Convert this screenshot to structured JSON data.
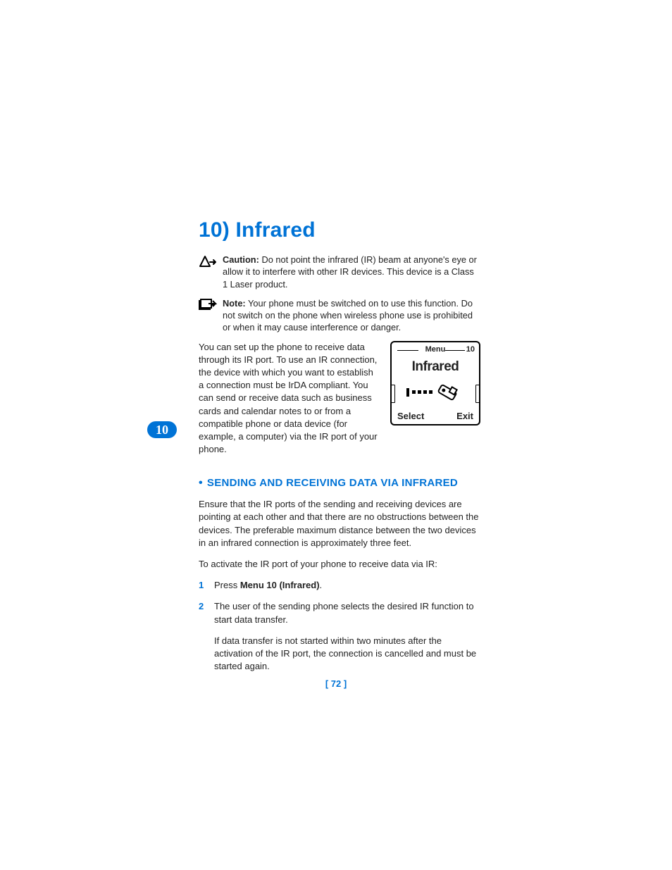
{
  "title": "10) Infrared",
  "caution": {
    "label": "Caution:",
    "text": " Do not point the infrared (IR) beam at anyone's eye or allow it to interfere with other IR devices. This device is a Class 1 Laser product."
  },
  "note": {
    "label": "Note:",
    "text": "  Your phone must be switched on to use this function. Do not switch on the phone when wireless phone use is prohibited or when it may cause interference or danger."
  },
  "intro": "You can set up the phone to receive data through its IR port. To use an IR connection, the device with which you want to establish a connection must be IrDA compliant. You can send or receive data such as business cards and calendar notes to or from a compatible phone or data device (for example, a computer) via the IR port of your phone.",
  "phone": {
    "menu_label": "Menu",
    "menu_number": "10",
    "title": "Infrared",
    "softkey_left": "Select",
    "softkey_right": "Exit"
  },
  "chapter_tab": "10",
  "section_heading": "SENDING AND RECEIVING DATA VIA INFRARED",
  "ensure_para": "Ensure that the IR ports of the sending and receiving devices are pointing at each other and that there are no obstructions between the devices. The preferable maximum distance between the two devices in an infrared connection is approximately three feet.",
  "activate_para": "To activate the IR port of your phone to receive data via IR:",
  "steps": {
    "s1_num": "1",
    "s1_prefix": "Press ",
    "s1_bold": "Menu 10 (Infrared)",
    "s1_suffix": ".",
    "s2_num": "2",
    "s2_text": "The user of the sending phone selects the desired IR function to start data transfer."
  },
  "timeout_para": "If data transfer is not started within two minutes after the activation of the IR port, the connection is cancelled and must be started again.",
  "page_number": "[ 72 ]"
}
